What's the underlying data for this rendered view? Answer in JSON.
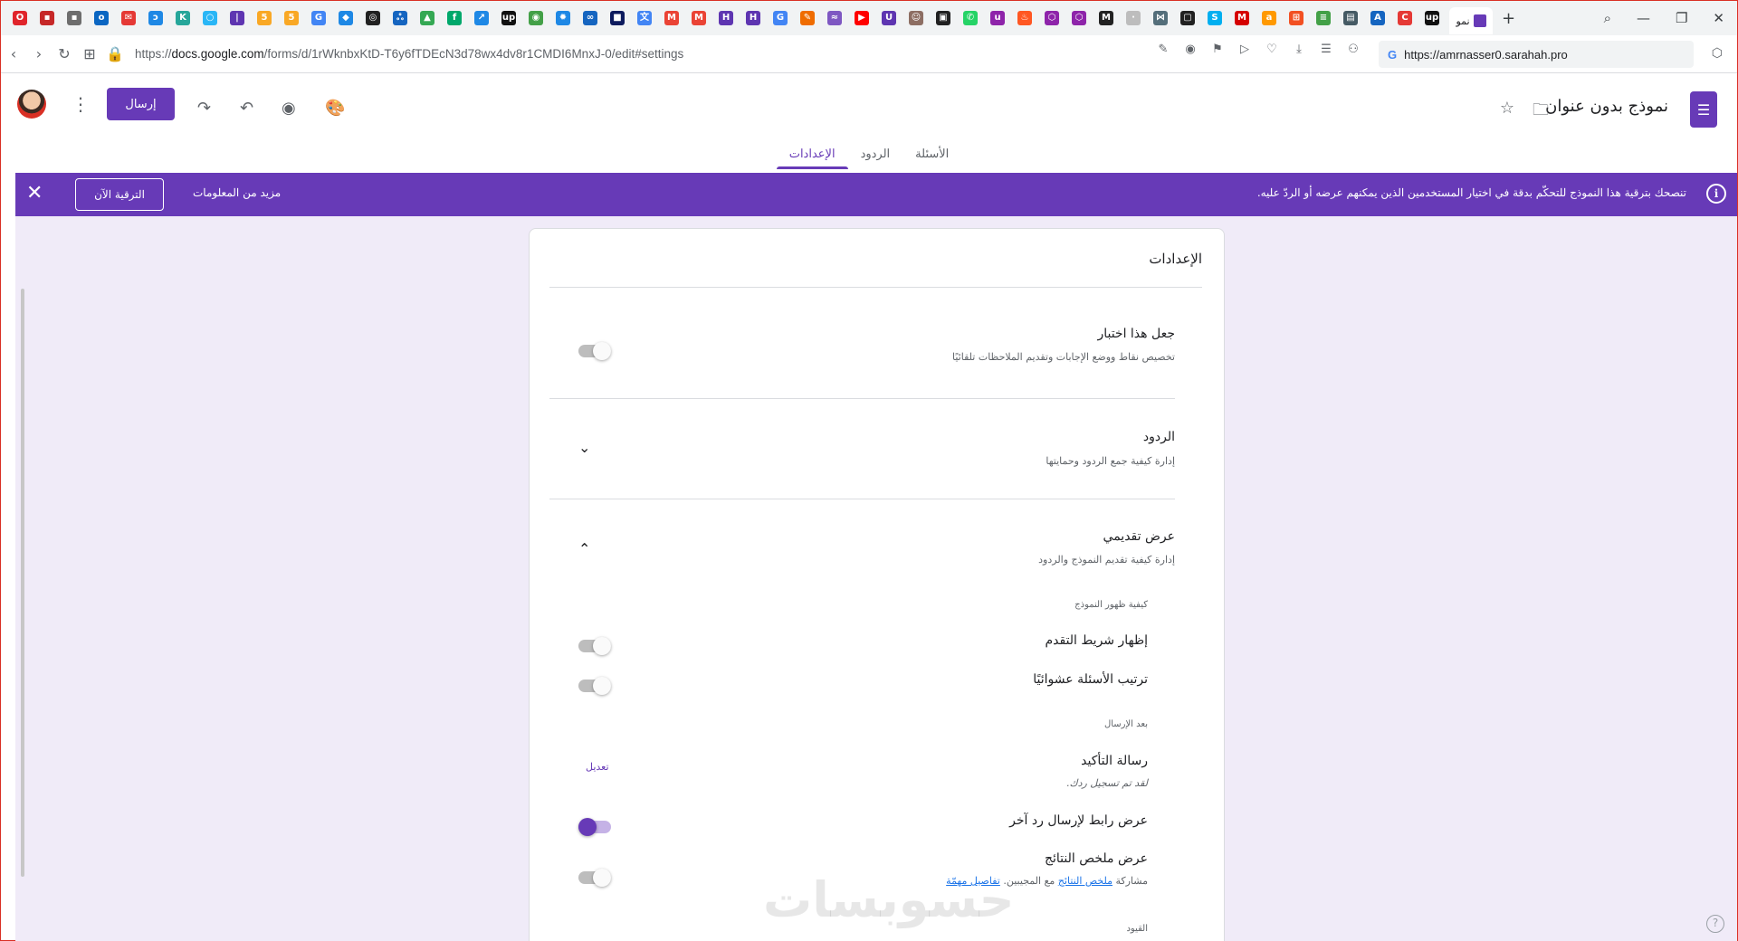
{
  "browser": {
    "tabs": [
      {
        "icon": "opera-icon",
        "color": "#e0242b",
        "glyph": "O"
      },
      {
        "icon": "app-red-icon",
        "color": "#c62828",
        "glyph": "▪"
      },
      {
        "icon": "photo-icon",
        "color": "#6d6d6d",
        "glyph": "▪"
      },
      {
        "icon": "outlook-icon",
        "color": "#0a66c2",
        "glyph": "o"
      },
      {
        "icon": "mail-red-icon",
        "color": "#e53935",
        "glyph": "✉"
      },
      {
        "icon": "hook-icon",
        "color": "#1e88e5",
        "glyph": "ɔ"
      },
      {
        "icon": "k-icon",
        "color": "#26a69a",
        "glyph": "K"
      },
      {
        "icon": "circle-blue-icon",
        "color": "#29b6f6",
        "glyph": "○"
      },
      {
        "icon": "purple-bar-icon",
        "color": "#5e35b1",
        "glyph": "|"
      },
      {
        "icon": "five-icon",
        "color": "#f9a825",
        "glyph": "5"
      },
      {
        "icon": "five-icon",
        "color": "#f9a825",
        "glyph": "5"
      },
      {
        "icon": "google-icon",
        "color": "#4285f4",
        "glyph": "G"
      },
      {
        "icon": "diamond-icon",
        "color": "#1e88e5",
        "glyph": "◆"
      },
      {
        "icon": "chat-icon",
        "color": "#212121",
        "glyph": "◎"
      },
      {
        "icon": "people-icon",
        "color": "#1565c0",
        "glyph": "ஃ"
      },
      {
        "icon": "drive-icon",
        "color": "#34a853",
        "glyph": "▲"
      },
      {
        "icon": "green-f-icon",
        "color": "#00a86b",
        "glyph": "f"
      },
      {
        "icon": "arrow-icon",
        "color": "#1e88e5",
        "glyph": "↗"
      },
      {
        "icon": "upwork-icon",
        "color": "#111111",
        "glyph": "up"
      },
      {
        "icon": "green-circle-icon",
        "color": "#43a047",
        "glyph": "◉"
      },
      {
        "icon": "gear-blue-icon",
        "color": "#1e88e5",
        "glyph": "✹"
      },
      {
        "icon": "infinity-icon",
        "color": "#1565c0",
        "glyph": "∞"
      },
      {
        "icon": "dark-square-icon",
        "color": "#0d1b5e",
        "glyph": "■"
      },
      {
        "icon": "translate-icon",
        "color": "#4285f4",
        "glyph": "文"
      },
      {
        "icon": "gmail-icon",
        "color": "#ea4335",
        "glyph": "M"
      },
      {
        "icon": "gmail-icon",
        "color": "#ea4335",
        "glyph": "M"
      },
      {
        "icon": "h-icon",
        "color": "#5e35b1",
        "glyph": "H"
      },
      {
        "icon": "h-icon",
        "color": "#5e35b1",
        "glyph": "H"
      },
      {
        "icon": "google-icon",
        "color": "#4285f4",
        "glyph": "G"
      },
      {
        "icon": "pen-icon",
        "color": "#ef6c00",
        "glyph": "✎"
      },
      {
        "icon": "swirl-icon",
        "color": "#7e57c2",
        "glyph": "≈"
      },
      {
        "icon": "youtube-icon",
        "color": "#ff0000",
        "glyph": "▶"
      },
      {
        "icon": "u-icon",
        "color": "#5e35b1",
        "glyph": "U"
      },
      {
        "icon": "person-icon",
        "color": "#8d6e63",
        "glyph": "☺"
      },
      {
        "icon": "tv-icon",
        "color": "#212121",
        "glyph": "▣"
      },
      {
        "icon": "whatsapp-icon",
        "color": "#25d366",
        "glyph": "✆"
      },
      {
        "icon": "purple-u-icon",
        "color": "#8e24aa",
        "glyph": "u"
      },
      {
        "icon": "fire-icon",
        "color": "#ff5722",
        "glyph": "♨"
      },
      {
        "icon": "shield-icon",
        "color": "#8e24aa",
        "glyph": "⬡"
      },
      {
        "icon": "shield-icon",
        "color": "#8e24aa",
        "glyph": "⬡"
      },
      {
        "icon": "m-icon",
        "color": "#222222",
        "glyph": "M"
      },
      {
        "icon": "blank-icon",
        "color": "#bdbdbd",
        "glyph": "·"
      },
      {
        "icon": "network-icon",
        "color": "#546e7a",
        "glyph": "⋈"
      },
      {
        "icon": "square-icon",
        "color": "#212121",
        "glyph": "▢"
      },
      {
        "icon": "skype-icon",
        "color": "#00aff0",
        "glyph": "S"
      },
      {
        "icon": "red-m-icon",
        "color": "#d50000",
        "glyph": "M"
      },
      {
        "icon": "amazon-icon",
        "color": "#ff9900",
        "glyph": "a"
      },
      {
        "icon": "windows-icon",
        "color": "#f25022",
        "glyph": "⊞"
      },
      {
        "icon": "lines-icon",
        "color": "#43a047",
        "glyph": "≡"
      },
      {
        "icon": "doc-icon",
        "color": "#455a64",
        "glyph": "▤"
      },
      {
        "icon": "a-icon",
        "color": "#1565c0",
        "glyph": "A"
      },
      {
        "icon": "c-icon",
        "color": "#e53935",
        "glyph": "C"
      },
      {
        "icon": "upwork-icon",
        "color": "#111111",
        "glyph": "up"
      }
    ],
    "active_tab_label": "نمو",
    "url_prefix": "https://",
    "url_domain": "docs.google.com",
    "url_path": "/forms/d/1rWknbxKtD-T6y6fTDEcN3d78wx4dv8r1CMDI6MnxJ-0/edit#settings",
    "side_url": "https://amrnasser0.sarahah.pro"
  },
  "header": {
    "form_title": "نموذج بدون عنوان",
    "send_label": "إرسال",
    "tabs": [
      {
        "label": "الأسئلة"
      },
      {
        "label": "الردود"
      },
      {
        "label": "الإعدادات"
      }
    ]
  },
  "banner": {
    "message": "تنصحك بترقية هذا النموذج للتحكّم بدقة في اختيار المستخدمين الذين يمكنهم عرضه أو الردّ عليه.",
    "more_info": "مزيد من المعلومات",
    "upgrade": "الترقية الآن"
  },
  "settings": {
    "title": "الإعدادات",
    "quiz": {
      "title": "جعل هذا اختبار",
      "desc": "تخصيص نقاط ووضع الإجابات وتقديم الملاحظات تلقائيًا"
    },
    "responses": {
      "title": "الردود",
      "desc": "إدارة كيفية جمع الردود وحمايتها"
    },
    "presentation": {
      "title": "عرض تقديمي",
      "desc": "إدارة كيفية تقديم النموذج والردود",
      "form_appearance_head": "كيفية ظهور النموذج",
      "progress_bar": "إظهار شريط التقدم",
      "shuffle": "ترتيب الأسئلة عشوائيًا",
      "after_submit_head": "بعد الإرسال",
      "confirmation_title": "رسالة التأكيد",
      "confirmation_text": "لقد تم تسجيل ردك.",
      "edit_label": "تعديل",
      "submit_another": "عرض رابط لإرسال رد آخر",
      "results_summary": "عرض ملخص النتائج",
      "share_prefix": "مشاركة",
      "share_link": "ملخص النتائج",
      "share_mid": "مع المجيبين.",
      "important_details": "تفاصيل مهمّة",
      "restrictions_head": "القيود"
    }
  },
  "watermark": "حسوبسات"
}
